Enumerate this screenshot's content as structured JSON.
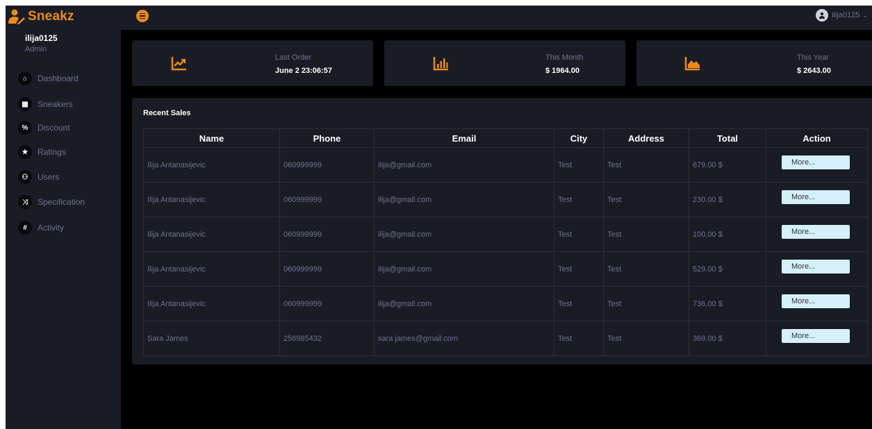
{
  "brand": {
    "name": "Sneakz",
    "accent": "#eb8a1b"
  },
  "user": {
    "name": "ilija0125",
    "role": "Admin"
  },
  "nav": [
    {
      "label": "Dashboard",
      "icon": "home-icon",
      "glyph": "⌂"
    },
    {
      "label": "Sneakers",
      "icon": "grid-icon",
      "glyph": "▦"
    },
    {
      "label": "Discount",
      "icon": "percent-icon",
      "glyph": "%"
    },
    {
      "label": "Ratings",
      "icon": "star-icon",
      "glyph": "★"
    },
    {
      "label": "Users",
      "icon": "users-icon",
      "glyph": "⚇"
    },
    {
      "label": "Specification",
      "icon": "shuffle-icon",
      "glyph": "⤨"
    },
    {
      "label": "Activity",
      "icon": "hash-icon",
      "glyph": "#"
    }
  ],
  "account": {
    "name": "ilija0125"
  },
  "stats": [
    {
      "label": "Last Order",
      "value": "June 2 23:06:57",
      "icon": "trend-chart-icon"
    },
    {
      "label": "This Month",
      "value": "$ 1964.00",
      "icon": "bar-chart-icon"
    },
    {
      "label": "This Year",
      "value": "$ 2643.00",
      "icon": "area-chart-icon"
    }
  ],
  "sales": {
    "title": "Recent Sales",
    "columns": [
      "Name",
      "Phone",
      "Email",
      "City",
      "Address",
      "Total",
      "Action"
    ],
    "rows": [
      [
        "Ilija Antanasijevic",
        "060999999",
        "ilija@gmail.com",
        "Test",
        "Test",
        "679.00 $",
        "More..."
      ],
      [
        "Ilija Antanasijevic",
        "060999999",
        "ilija@gmail.com",
        "Test",
        "Test",
        "230.00 $",
        "More..."
      ],
      [
        "Ilija Antanasijevic",
        "060999999",
        "ilija@gmail.com",
        "Test",
        "Test",
        "100.00 $",
        "More..."
      ],
      [
        "Ilija Antanasijevic",
        "060999999",
        "ilija@gmail.com",
        "Test",
        "Test",
        "529.00 $",
        "More..."
      ],
      [
        "Ilija Antanasijevic",
        "060999999",
        "ilija@gmail.com",
        "Test",
        "Test",
        "736.00 $",
        "More..."
      ],
      [
        "Sara James",
        "256985432",
        "sara.james@gmail.com",
        "Test",
        "Test",
        "369.00 $",
        "More..."
      ]
    ]
  }
}
